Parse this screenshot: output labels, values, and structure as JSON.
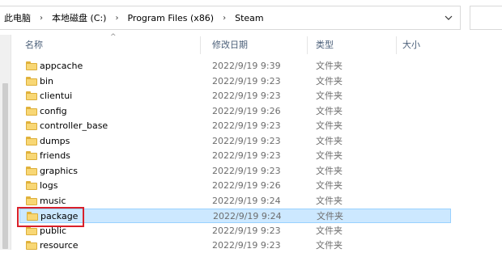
{
  "breadcrumb": [
    "此电脑",
    "本地磁盘 (C:)",
    "Program Files (x86)",
    "Steam"
  ],
  "columns": {
    "name": "名称",
    "date": "修改日期",
    "type": "类型",
    "size": "大小"
  },
  "files": [
    {
      "name": "appcache",
      "date": "2022/9/19 9:39",
      "type": "文件夹"
    },
    {
      "name": "bin",
      "date": "2022/9/19 9:23",
      "type": "文件夹"
    },
    {
      "name": "clientui",
      "date": "2022/9/19 9:23",
      "type": "文件夹"
    },
    {
      "name": "config",
      "date": "2022/9/19 9:26",
      "type": "文件夹"
    },
    {
      "name": "controller_base",
      "date": "2022/9/19 9:23",
      "type": "文件夹"
    },
    {
      "name": "dumps",
      "date": "2022/9/19 9:23",
      "type": "文件夹"
    },
    {
      "name": "friends",
      "date": "2022/9/19 9:23",
      "type": "文件夹"
    },
    {
      "name": "graphics",
      "date": "2022/9/19 9:23",
      "type": "文件夹"
    },
    {
      "name": "logs",
      "date": "2022/9/19 9:26",
      "type": "文件夹"
    },
    {
      "name": "music",
      "date": "2022/9/19 9:24",
      "type": "文件夹"
    },
    {
      "name": "package",
      "date": "2022/9/19 9:24",
      "type": "文件夹"
    },
    {
      "name": "public",
      "date": "2022/9/19 9:23",
      "type": "文件夹"
    },
    {
      "name": "resource",
      "date": "2022/9/19 9:23",
      "type": "文件夹"
    }
  ],
  "selected_file": "package",
  "colors": {
    "selection_bg": "#cce8ff",
    "selection_border": "#99d1ff",
    "highlight_box": "#d9202a",
    "folder": "#f8d775"
  },
  "icons": {
    "breadcrumb_separator": "chevron-right-icon",
    "address_dropdown": "chevron-down-icon",
    "refresh": "refresh-icon",
    "folder": "folder-icon",
    "sort": "sort-ascending-icon"
  }
}
